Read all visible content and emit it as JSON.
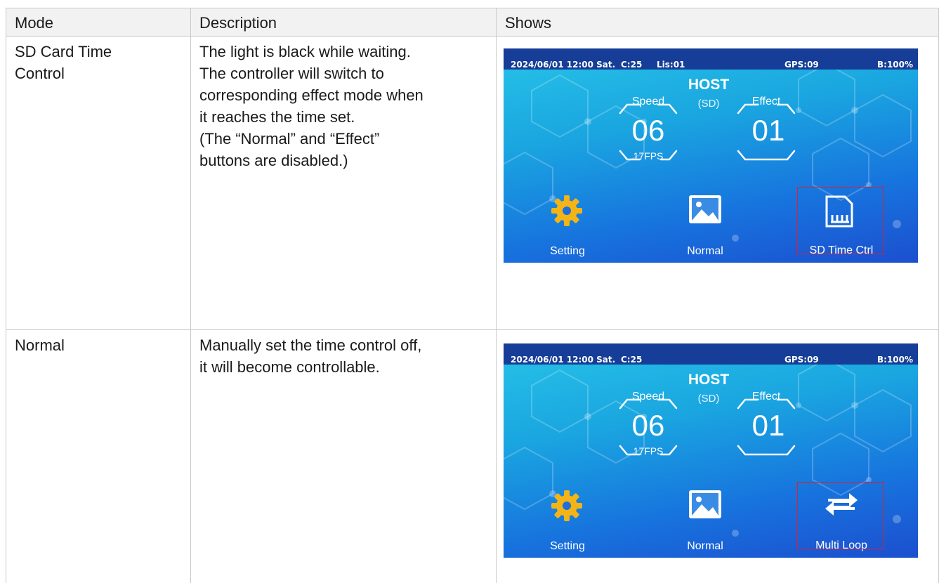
{
  "table": {
    "headers": {
      "mode": "Mode",
      "description": "Description",
      "shows": "Shows"
    },
    "rows": [
      {
        "mode": "SD Card Time Control",
        "description": [
          "The light is black while waiting.",
          "The controller will switch to",
          "corresponding effect mode when",
          "it reaches the time set.",
          "(The “Normal” and “Effect”",
          "buttons are disabled.)"
        ],
        "screen": {
          "status": {
            "date": "2024/06/01 12:00 Sat.",
            "c": "C:25",
            "lis": "Lis:01",
            "gps": "GPS:09",
            "battery": "B:100%"
          },
          "host": "HOST",
          "sd": "(SD)",
          "speed_label": "Speed",
          "speed_value": "06",
          "fps": "17FPS",
          "effect_label": "Effect",
          "effect_value": "01",
          "buttons": {
            "setting": "Setting",
            "normal": "Normal",
            "third": "SD Time Ctrl"
          },
          "icons": {
            "setting": "gear-icon",
            "normal": "image-icon",
            "third": "sd-card-icon"
          }
        }
      },
      {
        "mode": "Normal",
        "description": [
          "Manually set the time control off,",
          "it will become controllable."
        ],
        "screen": {
          "status": {
            "date": "2024/06/01 12:00 Sat.",
            "c": "C:25",
            "lis": "",
            "gps": "GPS:09",
            "battery": "B:100%"
          },
          "host": "HOST",
          "sd": "(SD)",
          "speed_label": "Speed",
          "speed_value": "06",
          "fps": "17FPS",
          "effect_label": "Effect",
          "effect_value": "01",
          "buttons": {
            "setting": "Setting",
            "normal": "Normal",
            "third": "Multi Loop"
          },
          "icons": {
            "setting": "gear-icon",
            "normal": "image-icon",
            "third": "loop-arrows-icon"
          }
        }
      }
    ]
  },
  "colors": {
    "statusbar": "#163d97",
    "highlight_box": "#e0202a",
    "gear": "#f5b416",
    "screen_top": "#27c3e8",
    "screen_bottom": "#1c4fcf"
  }
}
